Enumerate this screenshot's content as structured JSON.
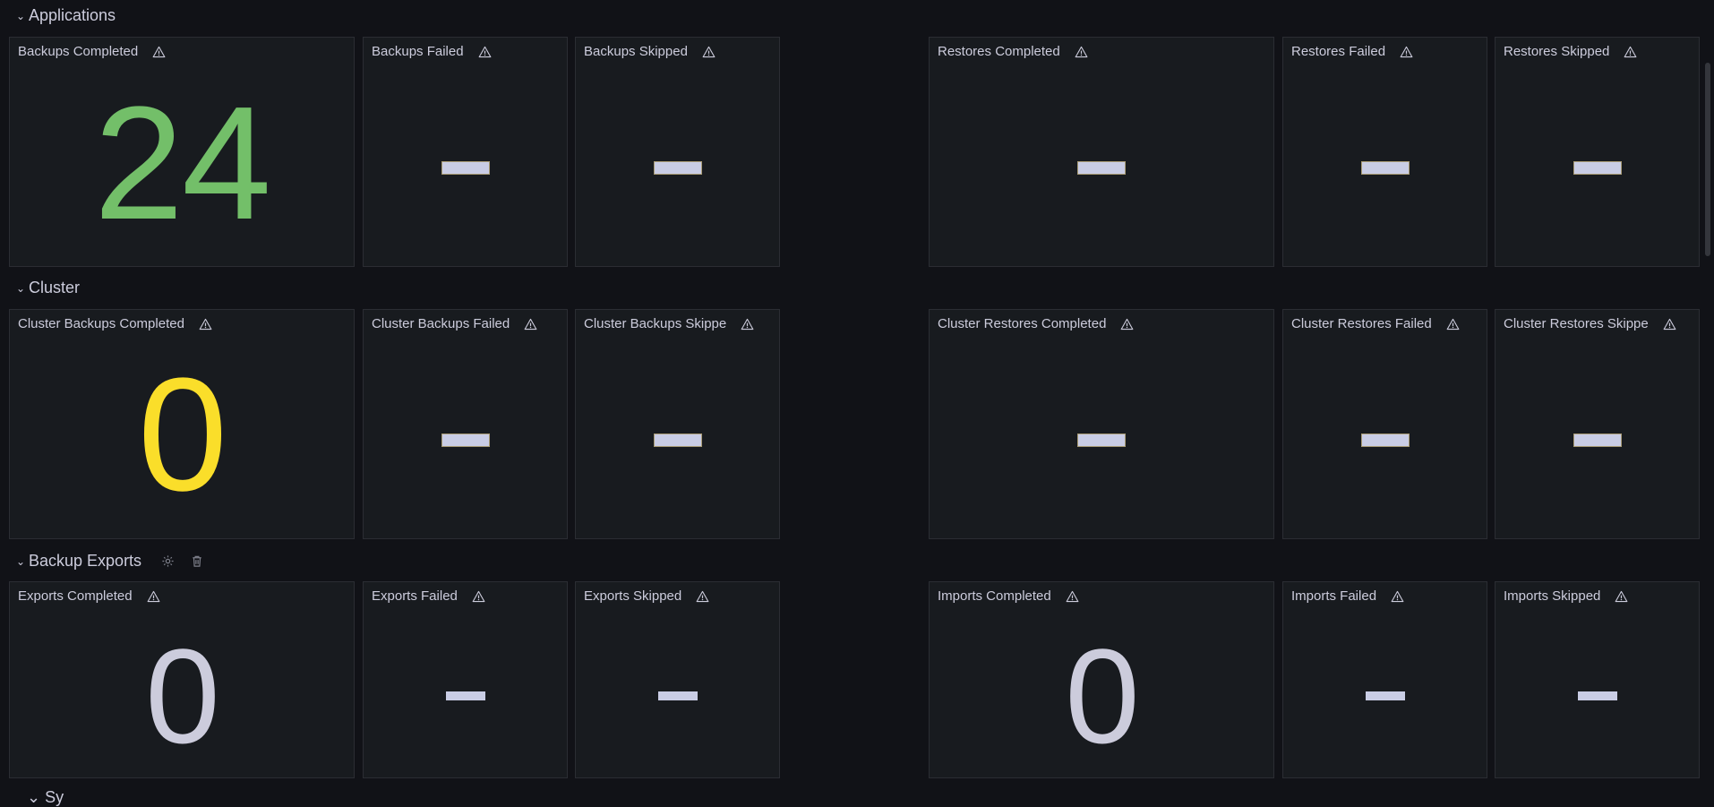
{
  "rows": [
    {
      "title": "Applications",
      "panels": [
        {
          "title": "Backups Completed",
          "value": "24",
          "color": "#73bf69"
        },
        {
          "title": "Backups Failed",
          "value": "-",
          "color": "#ccccdc"
        },
        {
          "title": "Backups Skipped",
          "value": "-",
          "color": "#ccccdc"
        },
        {
          "title": "Restores Completed",
          "value": "-",
          "color": "#ccccdc"
        },
        {
          "title": "Restores Failed",
          "value": "-",
          "color": "#ccccdc"
        },
        {
          "title": "Restores Skipped",
          "value": "-",
          "color": "#ccccdc"
        }
      ]
    },
    {
      "title": "Cluster",
      "panels": [
        {
          "title": "Cluster Backups Completed",
          "value": "0",
          "color": "#fade2a"
        },
        {
          "title": "Cluster Backups Failed",
          "value": "-",
          "color": "#ccccdc"
        },
        {
          "title": "Cluster Backups Skippe",
          "value": "-",
          "color": "#ccccdc"
        },
        {
          "title": "Cluster Restores Completed",
          "value": "-",
          "color": "#ccccdc"
        },
        {
          "title": "Cluster Restores Failed",
          "value": "-",
          "color": "#ccccdc"
        },
        {
          "title": "Cluster Restores Skippe",
          "value": "-",
          "color": "#ccccdc"
        }
      ]
    },
    {
      "title": "Backup Exports",
      "icons": [
        "gear-icon",
        "trash-icon"
      ],
      "panels": [
        {
          "title": "Exports Completed",
          "value": "0",
          "color": "#ccccdc"
        },
        {
          "title": "Exports Failed",
          "value": "-",
          "color": "#ccccdc"
        },
        {
          "title": "Exports Skipped",
          "value": "-",
          "color": "#ccccdc"
        },
        {
          "title": "Imports Completed",
          "value": "0",
          "color": "#ccccdc"
        },
        {
          "title": "Imports Failed",
          "value": "-",
          "color": "#ccccdc"
        },
        {
          "title": "Imports Skipped",
          "value": "-",
          "color": "#ccccdc"
        }
      ]
    }
  ],
  "colors": {
    "background": "#111217",
    "panel": "#181b1f",
    "panel_border": "#2b2d33",
    "green": "#73bf69",
    "yellow": "#fade2a",
    "text": "#ccccdc"
  }
}
